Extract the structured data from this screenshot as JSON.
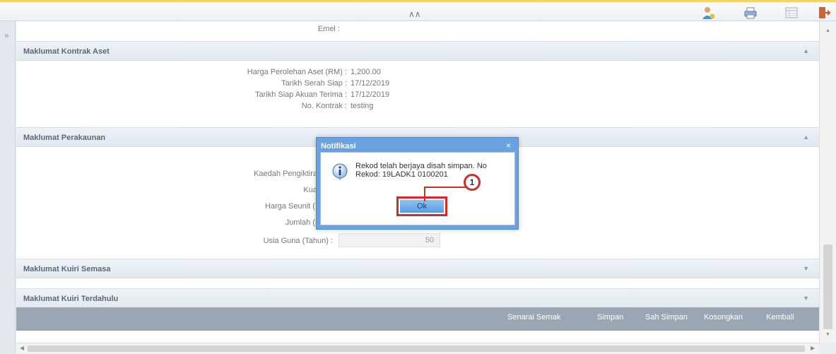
{
  "sections": {
    "kontrak": {
      "title": "Maklumat Kontrak Aset"
    },
    "perakaunan": {
      "title": "Maklumat Perakaunan"
    },
    "kuiri_semasa": {
      "title": "Maklumat Kuiri Semasa"
    },
    "kuiri_terdahulu": {
      "title": "Maklumat Kuiri Terdahulu"
    }
  },
  "fields": {
    "emel_label": "Emel :",
    "harga_perolehan_label": "Harga Perolehan Aset (RM) :",
    "harga_perolehan_value": "1,200.00",
    "tarikh_serah_label": "Tarikh Serah Siap :",
    "tarikh_serah_value": "17/12/2019",
    "tarikh_akuan_label": "Tarikh Siap Akuan Terima :",
    "tarikh_akuan_value": "17/12/2019",
    "no_kontrak_label": "No. Kontrak :",
    "no_kontrak_value": "testing",
    "kaedah_label": "Kaedah Pengiktira",
    "kua_label": "Kua",
    "harga_seunit_label": "Harga Seunit (I",
    "jumlah_label": "Jumlah (I",
    "usia_guna_label": "Usia Guna (Tahun) :",
    "usia_guna_value": "50"
  },
  "actions": {
    "senarai_semak": "Senarai Semak",
    "simpan": "Simpan",
    "sah_simpan": "Sah Simpan",
    "kosongkan": "Kosongkan",
    "kembali": "Kembali"
  },
  "dialog": {
    "title": "Notifikasi",
    "close": "×",
    "message": "Rekod telah berjaya disah simpan. No Rekod: 19LADK1 0100201",
    "ok_label": "Ok",
    "callout_number": "1"
  },
  "icons": {
    "collapse": "«",
    "expand": "»",
    "up": "▲",
    "down": "▼"
  },
  "colors": {
    "dialog_header": "#6aa2e0",
    "highlight": "#d22b2b",
    "footer_bar": "#9aa6b3"
  }
}
